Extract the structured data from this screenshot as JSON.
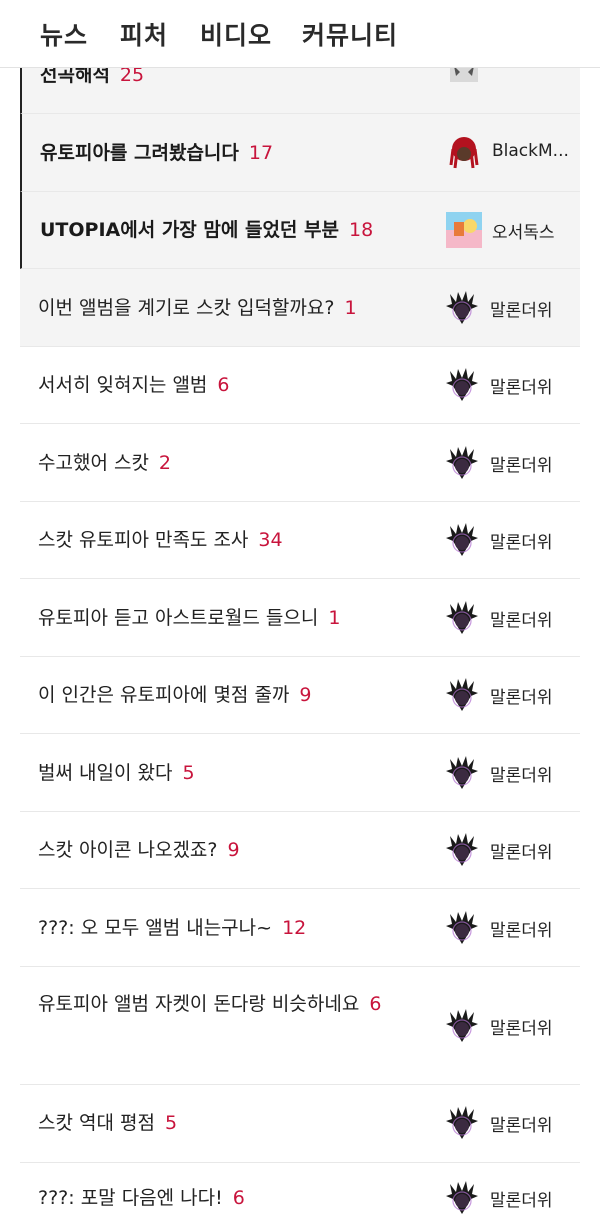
{
  "nav": {
    "items": [
      "뉴스",
      "피처",
      "비디오",
      "커뮤니티"
    ]
  },
  "posts": [
    {
      "title": "선곡해석",
      "count": "25",
      "author": "",
      "avatar_icon": "mask-avatar-icon",
      "pinned": true
    },
    {
      "title": "유토피아를 그려봤습니다",
      "count": "17",
      "author": "BlackM...",
      "avatar_icon": "red-hair-avatar-icon",
      "pinned": true
    },
    {
      "title": "UTOPIA에서 가장 맘에 들었던 부분",
      "count": "18",
      "author": "오서독스",
      "avatar_icon": "album-cover-avatar-icon",
      "pinned": true
    },
    {
      "title": "이번 앨범을 계기로 스캇 입덕할까요?",
      "count": "1",
      "author": "말론더위",
      "avatar_icon": "spiky-hair-avatar-icon"
    },
    {
      "title": "서서히 잊혀지는 앨범",
      "count": "6",
      "author": "말론더위",
      "avatar_icon": "spiky-hair-avatar-icon"
    },
    {
      "title": "수고했어 스캇",
      "count": "2",
      "author": "말론더위",
      "avatar_icon": "spiky-hair-avatar-icon"
    },
    {
      "title": "스캇 유토피아 만족도 조사",
      "count": "34",
      "author": "말론더위",
      "avatar_icon": "spiky-hair-avatar-icon"
    },
    {
      "title": "유토피아 듣고 아스트로월드 들으니",
      "count": "1",
      "author": "말론더위",
      "avatar_icon": "spiky-hair-avatar-icon"
    },
    {
      "title": "이 인간은 유토피아에 몇점 줄까",
      "count": "9",
      "author": "말론더위",
      "avatar_icon": "spiky-hair-avatar-icon"
    },
    {
      "title": "벌써 내일이 왔다",
      "count": "5",
      "author": "말론더위",
      "avatar_icon": "spiky-hair-avatar-icon"
    },
    {
      "title": "스캇 아이콘 나오겠죠?",
      "count": "9",
      "author": "말론더위",
      "avatar_icon": "spiky-hair-avatar-icon"
    },
    {
      "title": "???: 오 모두 앨범 내는구나~",
      "count": "12",
      "author": "말론더위",
      "avatar_icon": "spiky-hair-avatar-icon"
    },
    {
      "title": "유토피아 앨범 자켓이 돈다랑 비슷하네요",
      "count": "6",
      "author": "말론더위",
      "avatar_icon": "spiky-hair-avatar-icon"
    },
    {
      "title": "스캇 역대 평점",
      "count": "5",
      "author": "말론더위",
      "avatar_icon": "spiky-hair-avatar-icon"
    },
    {
      "title": "???: 포말 다음엔 나다!",
      "count": "6",
      "author": "말론더위",
      "avatar_icon": "spiky-hair-avatar-icon"
    }
  ],
  "colors": {
    "count": "#c8143c",
    "pinned_bg": "#f4f4f4",
    "divider": "#e8e8e8"
  }
}
